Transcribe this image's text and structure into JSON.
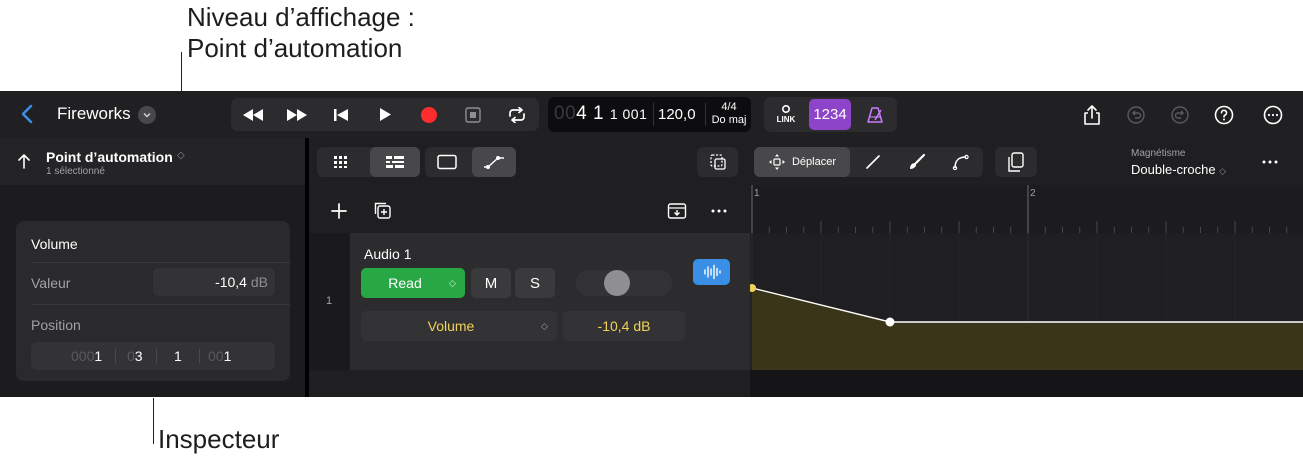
{
  "callouts": {
    "top_line1": "Niveau d’affichage :",
    "top_line2": "Point d’automation",
    "bottom": "Inspecteur"
  },
  "header": {
    "project_title": "Fireworks"
  },
  "lcd": {
    "position_dim": "00",
    "position_main": "4 1",
    "position_sub": "1 001",
    "tempo": "120,0",
    "signature": "4/4",
    "key": "Do maj"
  },
  "modes": {
    "link_label": "LINK",
    "count_in": "1234"
  },
  "inspector": {
    "level_title": "Point d’automation",
    "selection_count": "1 sélectionné",
    "section_title": "Volume",
    "value_label": "Valeur",
    "value": "-10,4",
    "value_unit": "dB",
    "position_label": "Position",
    "position": {
      "bar_dim": "000",
      "bar": "1",
      "beat_dim": "0",
      "beat": "3",
      "division": "1",
      "tick_dim": "00",
      "tick": "1"
    }
  },
  "editor": {
    "move_tool_label": "Déplacer",
    "snap_label": "Magnétisme",
    "snap_value": "Double-croche",
    "ruler_bars": [
      "1",
      "2"
    ]
  },
  "track": {
    "number": "1",
    "name": "Audio 1",
    "automation_mode": "Read",
    "mute_label": "M",
    "solo_label": "S",
    "parameter": "Volume",
    "parameter_value": "-10,4 dB"
  },
  "colors": {
    "read_green": "#28a745",
    "record_red": "#ff2d2d",
    "count_purple": "#8e44c9",
    "automation_yellow": "#f2d15a",
    "accent_blue": "#3a8ee6"
  },
  "automation": {
    "selected_point_index": 1,
    "points_beats": [
      0,
      2,
      8
    ]
  }
}
